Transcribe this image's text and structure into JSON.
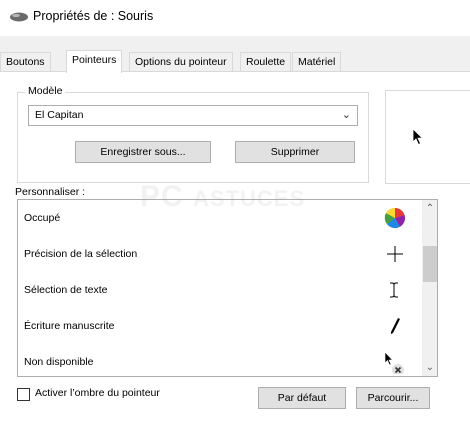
{
  "window": {
    "title": "Propriétés de : Souris",
    "icon": "mouse-icon"
  },
  "tabs": [
    {
      "label": "Boutons",
      "active": false
    },
    {
      "label": "Pointeurs",
      "active": true
    },
    {
      "label": "Options du pointeur",
      "active": false
    },
    {
      "label": "Roulette",
      "active": false
    },
    {
      "label": "Matériel",
      "active": false
    }
  ],
  "scheme": {
    "legend": "Modèle",
    "selected": "El Capitan",
    "save_label": "Enregistrer sous...",
    "delete_label": "Supprimer"
  },
  "customize": {
    "label": "Personnaliser :",
    "items": [
      {
        "label": "Occupé",
        "icon": "busy-spinner-icon"
      },
      {
        "label": "Précision de la sélection",
        "icon": "crosshair-icon"
      },
      {
        "label": "Sélection de texte",
        "icon": "text-beam-icon"
      },
      {
        "label": "Écriture manuscrite",
        "icon": "pen-icon"
      },
      {
        "label": "Non disponible",
        "icon": "unavailable-cursor-icon"
      }
    ]
  },
  "shadow": {
    "label": "Activer l’ombre du pointeur",
    "checked": false
  },
  "buttons": {
    "default_label": "Par défaut",
    "browse_label": "Parcourir..."
  },
  "watermark": {
    "text": "PC",
    "text2": "ASTUCES"
  },
  "colors": {
    "accent_border": "#adadad",
    "panel": "#ffffff",
    "chrome": "#f0f0f0"
  }
}
